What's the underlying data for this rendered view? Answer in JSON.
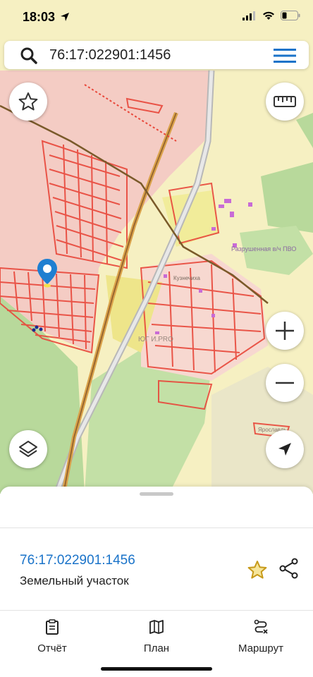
{
  "status": {
    "time": "18:03"
  },
  "search": {
    "query": "76:17:022901:1456"
  },
  "map": {
    "labels": {
      "unit": "Разрушенная в/ч ПВО",
      "village": "Кузнечиха",
      "watermark": "ЮГ И.PRO",
      "road": "Ярославль"
    }
  },
  "sheet": {
    "parcel_id": "76:17:022901:1456",
    "parcel_type": "Земельный участок"
  },
  "tabs": [
    {
      "label": "Отчёт"
    },
    {
      "label": "План"
    },
    {
      "label": "Маршрут"
    }
  ],
  "colors": {
    "accent": "#1a73c9",
    "parcel_red": "#e8473a",
    "road_orange": "#d9a14a",
    "forest_green": "#b8d99b",
    "field_yellow": "#f6f0c2",
    "pink_zone": "#f4ccc4"
  }
}
